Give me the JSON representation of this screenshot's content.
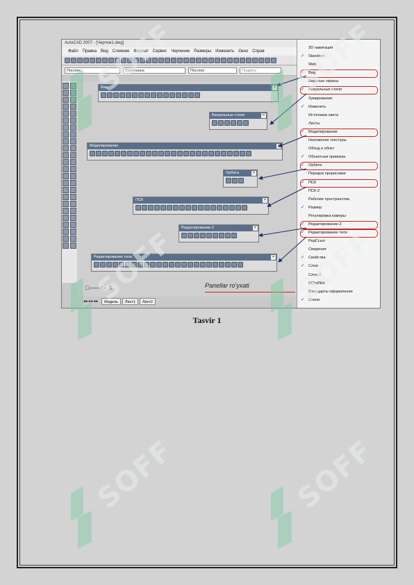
{
  "window": {
    "title": "AutoCAD 2007 - [Чертеж1.dwg]"
  },
  "menubar": [
    "Файл",
    "Правка",
    "Вид",
    "Слияние",
    "Формат",
    "Сервис",
    "Черчение",
    "Размеры",
    "Изменить",
    "Окно",
    "Справ"
  ],
  "properties_bar": {
    "layer": "Послою",
    "linetype": "Continuous",
    "lineweight": "Послою",
    "plotstyle": "Поцвету"
  },
  "panels": {
    "vid": "Вид",
    "visual_styles": "Визуальные стили",
    "modeling": "Моделирование",
    "orbit": "Орбита",
    "ucs": "ПСК",
    "edit2": "Редактирование-2",
    "solid_edit": "Редактирование тела"
  },
  "toolbar_menu": [
    {
      "label": "3D навигация",
      "checked": false,
      "highlight": false
    },
    {
      "label": "Standard",
      "checked": true,
      "highlight": false
    },
    {
      "label": "Web",
      "checked": false,
      "highlight": false
    },
    {
      "label": "Вид",
      "checked": true,
      "highlight": true
    },
    {
      "label": "Видовые экраны",
      "checked": false,
      "highlight": false
    },
    {
      "label": "Визуальные стили",
      "checked": true,
      "highlight": true
    },
    {
      "label": "Зумирование",
      "checked": false,
      "highlight": false
    },
    {
      "label": "Изменить",
      "checked": true,
      "highlight": false
    },
    {
      "label": "Источники света",
      "checked": false,
      "highlight": false
    },
    {
      "label": "Листы",
      "checked": false,
      "highlight": false
    },
    {
      "label": "Моделирование",
      "checked": true,
      "highlight": true
    },
    {
      "label": "Наложение текстуры",
      "checked": false,
      "highlight": false
    },
    {
      "label": "Обход и облет",
      "checked": false,
      "highlight": false
    },
    {
      "label": "Объектная привязка",
      "checked": true,
      "highlight": false
    },
    {
      "label": "Орбита",
      "checked": true,
      "highlight": true
    },
    {
      "label": "Порядок прорисовки",
      "checked": false,
      "highlight": false
    },
    {
      "label": "ПСК",
      "checked": true,
      "highlight": true
    },
    {
      "label": "ПСК-2",
      "checked": false,
      "highlight": false
    },
    {
      "label": "Рабочие пространства",
      "checked": false,
      "highlight": false
    },
    {
      "label": "Размер",
      "checked": true,
      "highlight": false
    },
    {
      "label": "Регулировка камеры",
      "checked": false,
      "highlight": false
    },
    {
      "label": "Редактирование-2",
      "checked": true,
      "highlight": true
    },
    {
      "label": "Редактирование тело",
      "checked": true,
      "highlight": true
    },
    {
      "label": "РедСсыл",
      "checked": false,
      "highlight": false
    },
    {
      "label": "Сведения",
      "checked": false,
      "highlight": false
    },
    {
      "label": "Свойства",
      "checked": true,
      "highlight": false
    },
    {
      "label": "Слои",
      "checked": true,
      "highlight": false
    },
    {
      "label": "Слои 2",
      "checked": false,
      "highlight": false
    },
    {
      "label": "ССЫЛКА",
      "checked": false,
      "highlight": false
    },
    {
      "label": "Стандарты оформления",
      "checked": false,
      "highlight": false
    },
    {
      "label": "Стили",
      "checked": true,
      "highlight": false
    }
  ],
  "tabs": [
    "Модель",
    "Лист1",
    "Лист2"
  ],
  "annotation": "Panellar ro'yxati",
  "ucs_axis": "X",
  "caption": "Tasvir 1",
  "watermark": "SOFF",
  "colors": {
    "highlight": "#cc2222",
    "panel_header": "#5b6f8a",
    "watermark": "#e8f0ee",
    "watermark_mark": "#7ac9a0"
  }
}
